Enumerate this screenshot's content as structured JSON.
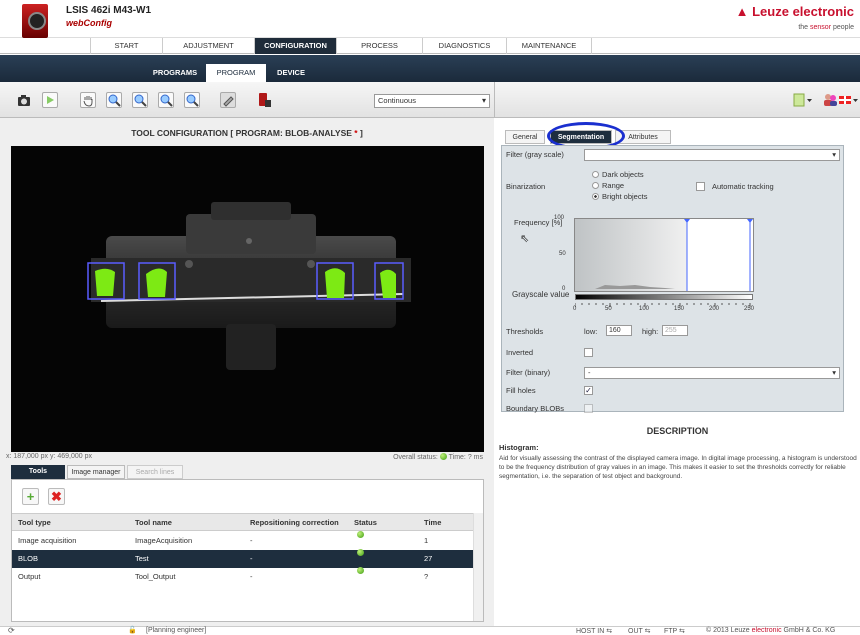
{
  "header": {
    "device_name": "LSIS 462i M43-W1",
    "app_name": "webConfig",
    "brand": "▲ Leuze electronic",
    "slogan_prefix": "the ",
    "slogan_accent": "sensor",
    "slogan_suffix": " people"
  },
  "main_nav": [
    "START",
    "ADJUSTMENT",
    "CONFIGURATION",
    "PROCESS",
    "DIAGNOSTICS",
    "MAINTENANCE"
  ],
  "main_nav_active": "CONFIGURATION",
  "sub_nav": [
    "PROGRAMS",
    "PROGRAM",
    "DEVICE"
  ],
  "sub_nav_active": "PROGRAM",
  "toolbar": {
    "mode_value": "Continuous"
  },
  "tool_config": {
    "title": "TOOL CONFIGURATION   [ PROGRAM: BLOB-ANALYSE",
    "unsaved_marker": " *",
    "title_close": " ]"
  },
  "viewer": {
    "coords": "x: 187,000 px y: 469,000 px",
    "overall_status_label": "Overall status:",
    "time_label": "Time: ? ms"
  },
  "lower_tabs": [
    "Tools",
    "Image manager",
    "Search lines"
  ],
  "tools_table": {
    "columns": [
      "Tool type",
      "Tool name",
      "Repositioning correction",
      "Status",
      "Time"
    ],
    "rows": [
      {
        "type": "Image acquisition",
        "name": "ImageAcquisition",
        "repos": "-",
        "status": "ok",
        "time": "1"
      },
      {
        "type": "BLOB",
        "name": "Test",
        "repos": "-",
        "status": "ok",
        "time": "27"
      },
      {
        "type": "Output",
        "name": "Tool_Output",
        "repos": "-",
        "status": "ok",
        "time": "?"
      }
    ]
  },
  "right_tabs": [
    "General",
    "Segmentation",
    "Attributes"
  ],
  "right_tab_active": "Segmentation",
  "segmentation": {
    "filter_gray_label": "Filter (gray scale)",
    "filter_gray_value": "",
    "binarization_label": "Binarization",
    "radio_options": [
      "Dark objects",
      "Range",
      "Bright objects"
    ],
    "radio_selected": "Bright objects",
    "auto_tracking_label": "Automatic tracking",
    "frequency_label": "Frequency [%]",
    "y_ticks": [
      "100",
      "50",
      "0"
    ],
    "grayscale_label": "Grayscale value",
    "x_ticks": [
      "0",
      "50",
      "100",
      "150",
      "200",
      "250"
    ],
    "thresholds_label": "Thresholds",
    "low_label": "low:",
    "low_value": "160",
    "high_label": "high:",
    "high_value": "255",
    "inverted_label": "Inverted",
    "filter_binary_label": "Filter (binary)",
    "filter_binary_value": "-",
    "fill_holes_label": "Fill holes",
    "boundary_label": "Boundary BLOBs"
  },
  "description": {
    "title": "DESCRIPTION",
    "heading": "Histogram:",
    "text": "Aid for visually assessing the contrast of the displayed camera image. In digital image processing, a histogram is understood to be the frequency distribution of gray values in an image. This makes it easier to set the thresholds correctly for reliable segmentation, i.e. the separation of test object and background."
  },
  "status_bar": {
    "user": "[Planning engineer]",
    "host": "HOST IN",
    "out": "OUT",
    "ftp": "FTP",
    "copyright_prefix": "© 2013 Leuze ",
    "copyright_accent": "electronic",
    "copyright_suffix": " GmbH & Co. KG"
  },
  "colors": {
    "nav_dark": "#1e2e3e",
    "brand_red": "#c8102e",
    "status_green": "#3c9b10",
    "highlight_blue": "#1a2fcf"
  }
}
